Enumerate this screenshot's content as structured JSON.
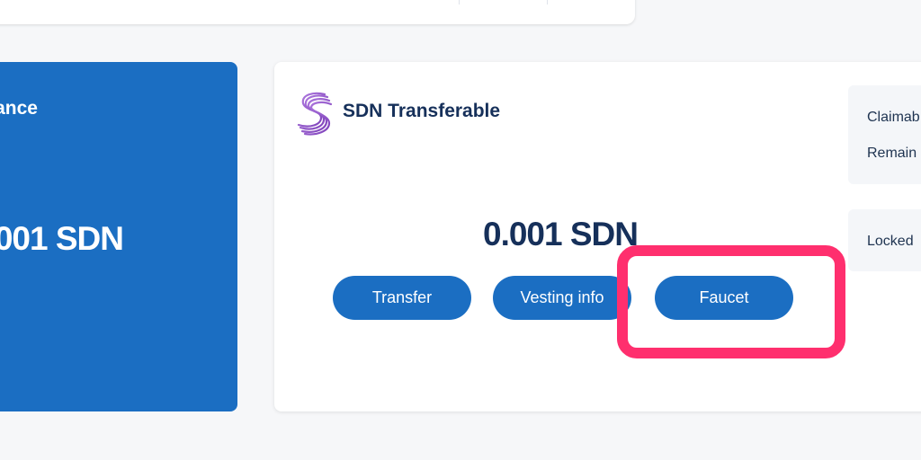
{
  "balance_card": {
    "title": "ance",
    "amount": ".001 SDN",
    "bg_color": "#1b6ec2"
  },
  "transferable_card": {
    "logo_icon": "shiden-logo-icon",
    "title": "SDN Transferable",
    "amount": "0.001 SDN",
    "buttons": {
      "transfer": "Transfer",
      "vesting": "Vesting info",
      "faucet": "Faucet"
    },
    "info": {
      "claimable": "Claimab",
      "remaining": "Remain",
      "locked": "Locked"
    }
  },
  "colors": {
    "accent": "#1b6ec2",
    "title_text": "#16305a",
    "highlight": "#ff2f6e",
    "background": "#f6f7f9"
  }
}
